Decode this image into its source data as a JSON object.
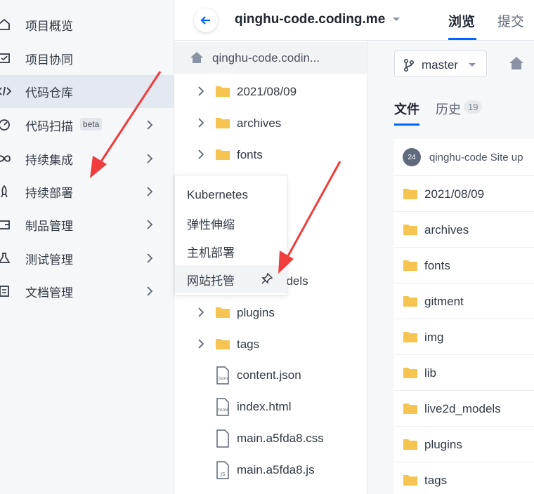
{
  "sidebar": {
    "items": [
      {
        "label": "项目概览",
        "icon": "home-icon",
        "chevron": false,
        "active": false
      },
      {
        "label": "项目协同",
        "icon": "board-icon",
        "chevron": false,
        "active": false
      },
      {
        "label": "代码仓库",
        "icon": "code-icon",
        "chevron": false,
        "active": true
      },
      {
        "label": "代码扫描",
        "icon": "scan-icon",
        "chevron": true,
        "active": false,
        "badge": "beta"
      },
      {
        "label": "持续集成",
        "icon": "infinity-icon",
        "chevron": true,
        "active": false
      },
      {
        "label": "持续部署",
        "icon": "rocket-icon",
        "chevron": true,
        "active": false
      },
      {
        "label": "制品管理",
        "icon": "package-icon",
        "chevron": true,
        "active": false
      },
      {
        "label": "测试管理",
        "icon": "flask-icon",
        "chevron": true,
        "active": false
      },
      {
        "label": "文档管理",
        "icon": "document-icon",
        "chevron": true,
        "active": false
      }
    ]
  },
  "header": {
    "repo_title": "qinghu-code.coding.me",
    "tabs": [
      "浏览",
      "提交"
    ]
  },
  "tree": {
    "root": "qinghu-code.codin...",
    "items": [
      {
        "label": "2021/08/09",
        "type": "folder"
      },
      {
        "label": "archives",
        "type": "folder"
      },
      {
        "label": "fonts",
        "type": "folder"
      },
      {
        "label": "odels",
        "type": "folder"
      },
      {
        "label": "plugins",
        "type": "folder"
      },
      {
        "label": "tags",
        "type": "folder"
      },
      {
        "label": "content.json",
        "type": "file",
        "badge": "json"
      },
      {
        "label": "index.html",
        "type": "file",
        "badge": "html"
      },
      {
        "label": "main.a5fda8.css",
        "type": "file",
        "badge": ""
      },
      {
        "label": "main.a5fda8.js",
        "type": "file",
        "badge": "JS"
      }
    ]
  },
  "popup": {
    "items": [
      "Kubernetes",
      "弹性伸缩",
      "主机部署",
      "网站托管"
    ]
  },
  "content": {
    "branch": "master",
    "tabs": {
      "files": "文件",
      "history": "历史",
      "history_count": "19"
    },
    "commit": {
      "avatar": "24",
      "text": "qinghu-code  Site up"
    },
    "files": [
      "2021/08/09",
      "archives",
      "fonts",
      "gitment",
      "img",
      "lib",
      "live2d_models",
      "plugins",
      "tags"
    ]
  },
  "colors": {
    "accent": "#0066ff",
    "folder": "#f5c451",
    "arrow": "#f03c3c"
  }
}
